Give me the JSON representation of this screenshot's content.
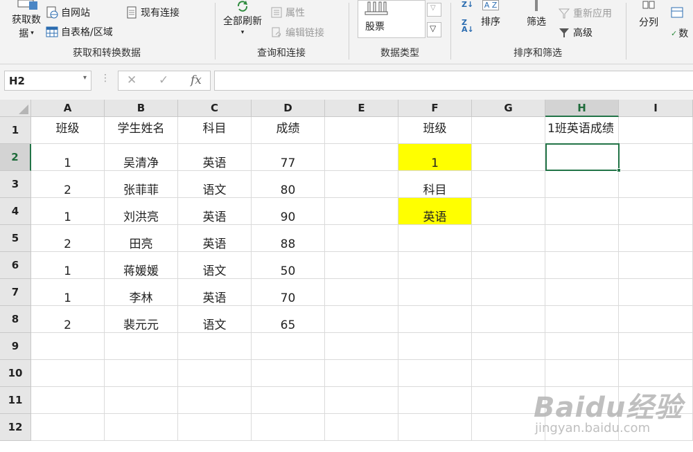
{
  "ribbon": {
    "get_data": {
      "line1": "获取数",
      "line2": "据"
    },
    "from_web": "自网站",
    "existing_connections": "现有连接",
    "from_table": "自表格/区域",
    "group_get_transform": "获取和转换数据",
    "refresh_all": "全部刷新",
    "properties": "属性",
    "edit_links": "编辑链接",
    "group_queries": "查询和连接",
    "stock": "股票",
    "group_data_types": "数据类型",
    "sort": "排序",
    "filter": "筛选",
    "reapply": "重新应用",
    "advanced": "高级",
    "group_sort_filter": "排序和筛选",
    "text_to_columns": "分列",
    "partial_right": "数"
  },
  "formula_bar": {
    "name_box": "H2",
    "fx": "fx",
    "cancel": "✕",
    "enter": "✓",
    "content": ""
  },
  "sheet": {
    "columns": [
      "A",
      "B",
      "C",
      "D",
      "E",
      "F",
      "G",
      "H",
      "I"
    ],
    "rows": [
      "1",
      "2",
      "3",
      "4",
      "5",
      "6",
      "7",
      "8",
      "9",
      "10",
      "11",
      "12"
    ],
    "active_cell": "H2",
    "cells": {
      "A1": "班级",
      "B1": "学生姓名",
      "C1": "科目",
      "D1": "成绩",
      "F1": "班级",
      "H1": "1班英语成绩",
      "A2": "1",
      "B2": "吴清净",
      "C2": "英语",
      "D2": "77",
      "F2": "1",
      "A3": "2",
      "B3": "张菲菲",
      "C3": "语文",
      "D3": "80",
      "F3": "科目",
      "A4": "1",
      "B4": "刘洪亮",
      "C4": "英语",
      "D4": "90",
      "F4": "英语",
      "A5": "2",
      "B5": "田亮",
      "C5": "英语",
      "D5": "88",
      "A6": "1",
      "B6": "蒋媛媛",
      "C6": "语文",
      "D6": "50",
      "A7": "1",
      "B7": "李林",
      "C7": "英语",
      "D7": "70",
      "A8": "2",
      "B8": "裴元元",
      "C8": "语文",
      "D8": "65"
    },
    "highlight_color": "#ffff00",
    "selection_color": "#217346"
  },
  "watermark": {
    "brand": "Baidu经验",
    "url": "jingyan.baidu.com"
  }
}
